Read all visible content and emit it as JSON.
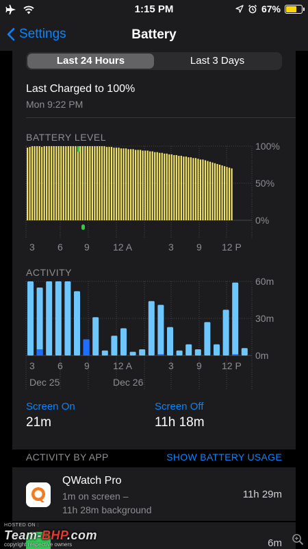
{
  "status_bar": {
    "time": "1:15 PM",
    "battery_percent": "67%",
    "battery_level": 0.67
  },
  "nav": {
    "back_label": "Settings",
    "title": "Battery"
  },
  "segments": {
    "items": [
      "Last 24 Hours",
      "Last 3 Days"
    ],
    "selected": "Last 24 Hours"
  },
  "charge": {
    "title": "Last Charged to 100%",
    "time": "Mon 9:22 PM"
  },
  "battery_section": {
    "label": "BATTERY LEVEL"
  },
  "activity_section": {
    "label": "ACTIVITY"
  },
  "stats": {
    "screen_on_label": "Screen On",
    "screen_on_value": "21m",
    "screen_off_label": "Screen Off",
    "screen_off_value": "11h 18m"
  },
  "app_header": {
    "left": "ACTIVITY BY APP",
    "right": "SHOW BATTERY USAGE"
  },
  "apps": [
    {
      "name": "QWatch Pro",
      "line1": "1m on screen –",
      "line2": "11h 28m background",
      "time": "11h 29m"
    },
    {
      "name": "",
      "time": "6m"
    }
  ],
  "watermark": {
    "hosted": "HOSTED ON :",
    "brand_a": "Team-",
    "brand_b": "BHP",
    "brand_c": ".com",
    "copy": "copyright respective owners"
  },
  "chart_data": [
    {
      "type": "bar",
      "title": "BATTERY LEVEL",
      "x_tick_labels": [
        "3",
        "6",
        "9",
        "12 A",
        "3",
        "6",
        "9",
        "12 P"
      ],
      "y_tick_labels": [
        "100%",
        "50%",
        "0%"
      ],
      "ylim": [
        0,
        100
      ],
      "grid": true,
      "color": "#f5e663",
      "values": [
        98,
        99,
        100,
        100,
        100,
        100,
        99,
        100,
        100,
        100,
        100,
        100,
        100,
        100,
        100,
        100,
        100,
        100,
        100,
        100,
        100,
        100,
        100,
        100,
        100,
        100,
        100,
        100,
        100,
        100,
        100,
        100,
        100,
        99,
        99,
        99,
        98,
        98,
        98,
        97,
        97,
        97,
        96,
        96,
        96,
        95,
        95,
        95,
        94,
        94,
        94,
        93,
        93,
        92,
        92,
        91,
        91,
        90,
        90,
        89,
        89,
        88,
        88,
        87,
        87,
        86,
        86,
        85,
        85,
        84,
        84,
        83,
        82,
        82,
        81,
        80,
        79,
        78,
        77,
        76,
        75,
        74,
        73,
        72,
        71,
        70
      ],
      "charging_markers": [
        {
          "index": 21
        }
      ]
    },
    {
      "type": "bar",
      "title": "ACTIVITY",
      "x_tick_labels": [
        "3",
        "6",
        "9",
        "12 A",
        "3",
        "6",
        "9",
        "12 P"
      ],
      "date_labels": [
        "Dec 25",
        "Dec 26"
      ],
      "y_tick_labels": [
        "60m",
        "30m",
        "0m"
      ],
      "ylim": [
        0,
        60
      ],
      "grid": true,
      "series": [
        {
          "name": "Screen On",
          "color": "#1e6fff",
          "values": [
            0,
            5,
            0,
            0,
            0,
            0,
            13,
            0,
            0,
            0,
            0,
            0,
            0,
            0,
            1,
            0,
            0,
            0,
            0,
            0,
            0,
            0,
            1,
            0
          ]
        },
        {
          "name": "Screen Off",
          "color": "#6ec6ff",
          "values": [
            60,
            55,
            60,
            60,
            60,
            52,
            13,
            31,
            4,
            16,
            22,
            3,
            5,
            44,
            41,
            23,
            4,
            9,
            5,
            27,
            9,
            37,
            59,
            6
          ]
        }
      ]
    }
  ]
}
